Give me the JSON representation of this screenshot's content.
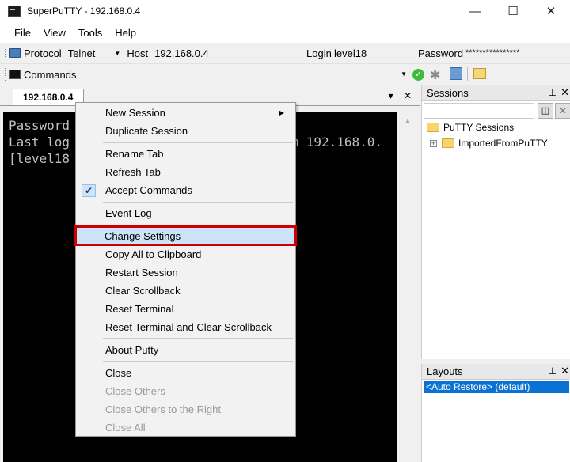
{
  "window": {
    "title": "SuperPuTTY - 192.168.0.4",
    "minimize": "—",
    "maximize": "☐",
    "close": "✕"
  },
  "menubar": [
    "File",
    "View",
    "Tools",
    "Help"
  ],
  "connection_toolbar": {
    "protocol_label": "Protocol",
    "protocol_value": "Telnet",
    "host_label": "Host",
    "host_value": "192.168.0.4",
    "login_label": "Login",
    "login_value": "level18",
    "password_label": "Password",
    "password_value": "****************"
  },
  "commands_toolbar": {
    "label": "Commands"
  },
  "document_tab": {
    "label": "192.168.0.4",
    "dropdown": "▾",
    "close": "✕"
  },
  "terminal": {
    "lines": [
      "Password",
      "Last log                             m 192.168.0.",
      "[level18"
    ]
  },
  "sessions_panel": {
    "title": "Sessions",
    "pin": "ᴕ",
    "close": "✕",
    "root": "PuTTY Sessions",
    "child": "ImportedFromPuTTY"
  },
  "layouts_panel": {
    "title": "Layouts",
    "pin": "ᴕ",
    "close": "✕",
    "selected": "<Auto Restore> (default)"
  },
  "context_menu": {
    "items": [
      {
        "label": "New Session",
        "submenu": true
      },
      {
        "label": "Duplicate Session"
      },
      {
        "label": "Rename Tab"
      },
      {
        "label": "Refresh Tab"
      },
      {
        "label": "Accept Commands",
        "checked": true
      },
      {
        "label": "Event Log"
      },
      {
        "label": "Change Settings",
        "highlighted": true
      },
      {
        "label": "Copy All to Clipboard"
      },
      {
        "label": "Restart Session"
      },
      {
        "label": "Clear Scrollback"
      },
      {
        "label": "Reset Terminal"
      },
      {
        "label": "Reset Terminal and Clear Scrollback"
      },
      {
        "label": "About Putty"
      },
      {
        "label": "Close"
      },
      {
        "label": "Close Others",
        "disabled": true
      },
      {
        "label": "Close Others to the Right",
        "disabled": true
      },
      {
        "label": "Close All",
        "disabled": true
      }
    ]
  },
  "colors": {
    "highlight_border": "#cc0000",
    "selection_blue": "#0a72d4",
    "terminal_bg": "#000000"
  }
}
